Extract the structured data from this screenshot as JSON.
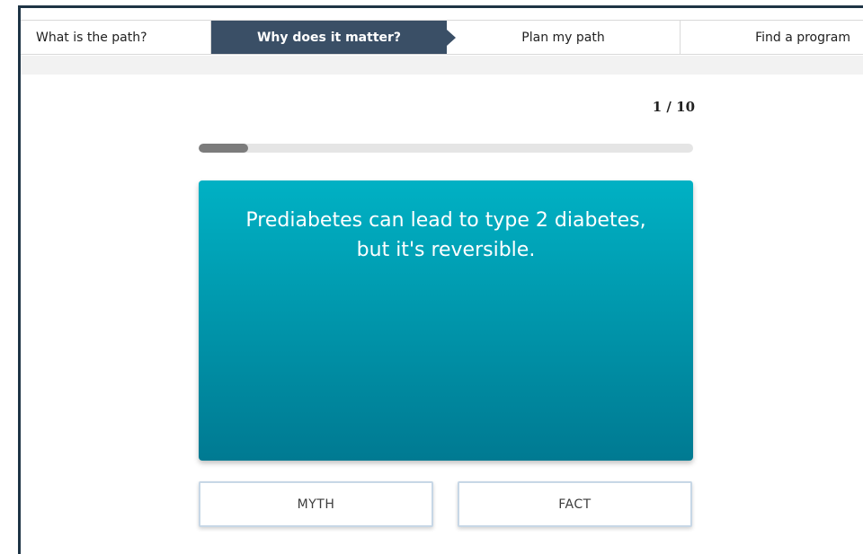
{
  "tabs": [
    {
      "label": "What is the path?",
      "active": false
    },
    {
      "label": "Why does it matter?",
      "active": true
    },
    {
      "label": "Plan my path",
      "active": false
    },
    {
      "label": "Find a program",
      "active": false
    }
  ],
  "quiz": {
    "counter": "1 / 10",
    "progress_fraction": 0.1,
    "statement": "Prediabetes can lead to type 2 diabetes, but it's reversible.",
    "buttons": {
      "myth": "MYTH",
      "fact": "FACT"
    }
  },
  "colors": {
    "active_tab": "#3a4f66",
    "card_top": "#00b1c4",
    "card_bottom": "#007a92",
    "progress_fill": "#7c7c7c",
    "button_border": "#c7d7e6"
  }
}
